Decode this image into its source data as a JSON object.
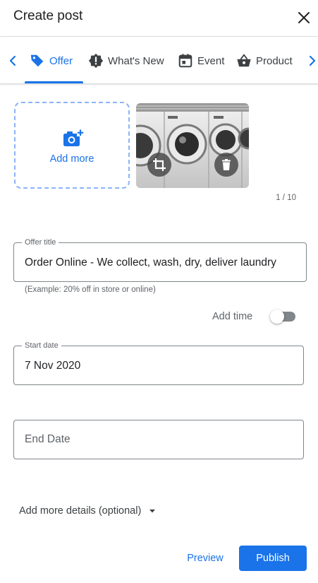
{
  "header": {
    "title": "Create post"
  },
  "tabs": [
    {
      "label": "Offer",
      "icon": "tag-icon",
      "active": true
    },
    {
      "label": "What's New",
      "icon": "badge-alert-icon"
    },
    {
      "label": "Event",
      "icon": "calendar-icon"
    },
    {
      "label": "Product",
      "icon": "basket-icon"
    }
  ],
  "media": {
    "add_more_label": "Add more",
    "counter": "1 / 10"
  },
  "offer_title": {
    "label": "Offer title",
    "value": "Order Online - We collect, wash, dry, deliver laundry",
    "helper": "(Example: 20% off in store or online)"
  },
  "add_time": {
    "label": "Add time",
    "on": false
  },
  "start_date": {
    "label": "Start date",
    "value": "7 Nov 2020"
  },
  "end_date": {
    "placeholder": "End Date"
  },
  "more_details": {
    "label": "Add more details (optional)"
  },
  "actions": {
    "preview": "Preview",
    "publish": "Publish"
  },
  "colors": {
    "accent": "#1a73e8",
    "text": "#202124",
    "muted": "#5f6368",
    "border": "#80868b"
  }
}
